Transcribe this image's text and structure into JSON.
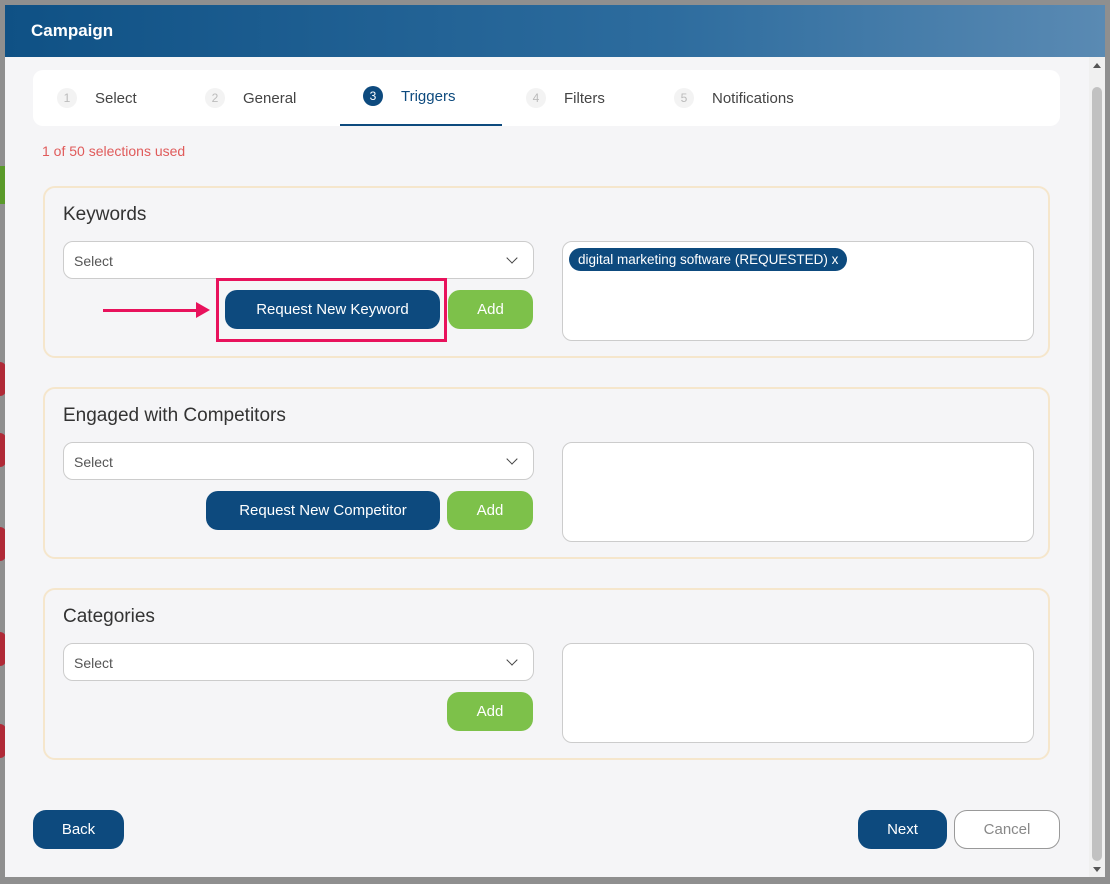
{
  "modal": {
    "title": "Campaign"
  },
  "steps": [
    {
      "num": "1",
      "label": "Select"
    },
    {
      "num": "2",
      "label": "General"
    },
    {
      "num": "3",
      "label": "Triggers"
    },
    {
      "num": "4",
      "label": "Filters"
    },
    {
      "num": "5",
      "label": "Notifications"
    }
  ],
  "active_step": "Triggers",
  "usage_text": "1 of 50 selections used",
  "sections": {
    "keywords": {
      "title": "Keywords",
      "select_placeholder": "Select",
      "request_label": "Request New Keyword",
      "add_label": "Add",
      "selected": [
        "digital marketing software (REQUESTED) x"
      ]
    },
    "competitors": {
      "title": "Engaged with Competitors",
      "select_placeholder": "Select",
      "request_label": "Request New Competitor",
      "add_label": "Add",
      "selected": []
    },
    "categories": {
      "title": "Categories",
      "select_placeholder": "Select",
      "add_label": "Add",
      "selected": []
    }
  },
  "footer": {
    "back_label": "Back",
    "next_label": "Next",
    "cancel_label": "Cancel"
  },
  "colors": {
    "navy": "#0d4a7e",
    "green": "#7dc14a",
    "usage_text": "#e05b5b",
    "annotation": "#e8125c",
    "section_border": "#f5e6cc"
  },
  "icons": {
    "dropdown": "chevron-down-icon",
    "annotation_arrow": "arrow-right-icon"
  }
}
